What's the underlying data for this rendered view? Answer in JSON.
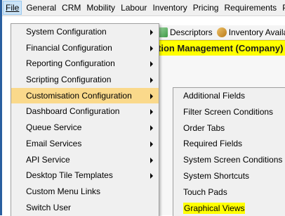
{
  "menubar": {
    "items": [
      "File",
      "General",
      "CRM",
      "Mobility",
      "Labour",
      "Inventory",
      "Pricing",
      "Requirements",
      "P"
    ]
  },
  "background": {
    "toolbar": {
      "descriptors_label": "Descriptors",
      "inventory_label": "Inventory Availabi"
    },
    "window_title": "tion Management (Company)",
    "window_title_tail": "»"
  },
  "file_menu": {
    "items": [
      {
        "label": "System Configuration",
        "has_submenu": true
      },
      {
        "label": "Financial Configuration",
        "has_submenu": true
      },
      {
        "label": "Reporting Configuration",
        "has_submenu": true
      },
      {
        "label": "Scripting Configuration",
        "has_submenu": true
      },
      {
        "label": "Customisation Configuration",
        "has_submenu": true
      },
      {
        "label": "Dashboard Configuration",
        "has_submenu": true
      },
      {
        "label": "Queue Service",
        "has_submenu": true
      },
      {
        "label": "Email Services",
        "has_submenu": true
      },
      {
        "label": "API Service",
        "has_submenu": true
      },
      {
        "label": "Desktop Tile Templates",
        "has_submenu": true
      },
      {
        "label": "Custom Menu Links",
        "has_submenu": false
      },
      {
        "label": "Switch User",
        "has_submenu": false
      }
    ],
    "highlighted_index": 4,
    "highlight_color": "#fad98b"
  },
  "customisation_submenu": {
    "items": [
      "Additional Fields",
      "Filter Screen Conditions",
      "Order Tabs",
      "Required Fields",
      "System Screen Conditions",
      "System Shortcuts",
      "Touch Pads",
      "Graphical Views"
    ],
    "text_highlight_index": 7,
    "text_highlight_color": "#ffff00"
  }
}
